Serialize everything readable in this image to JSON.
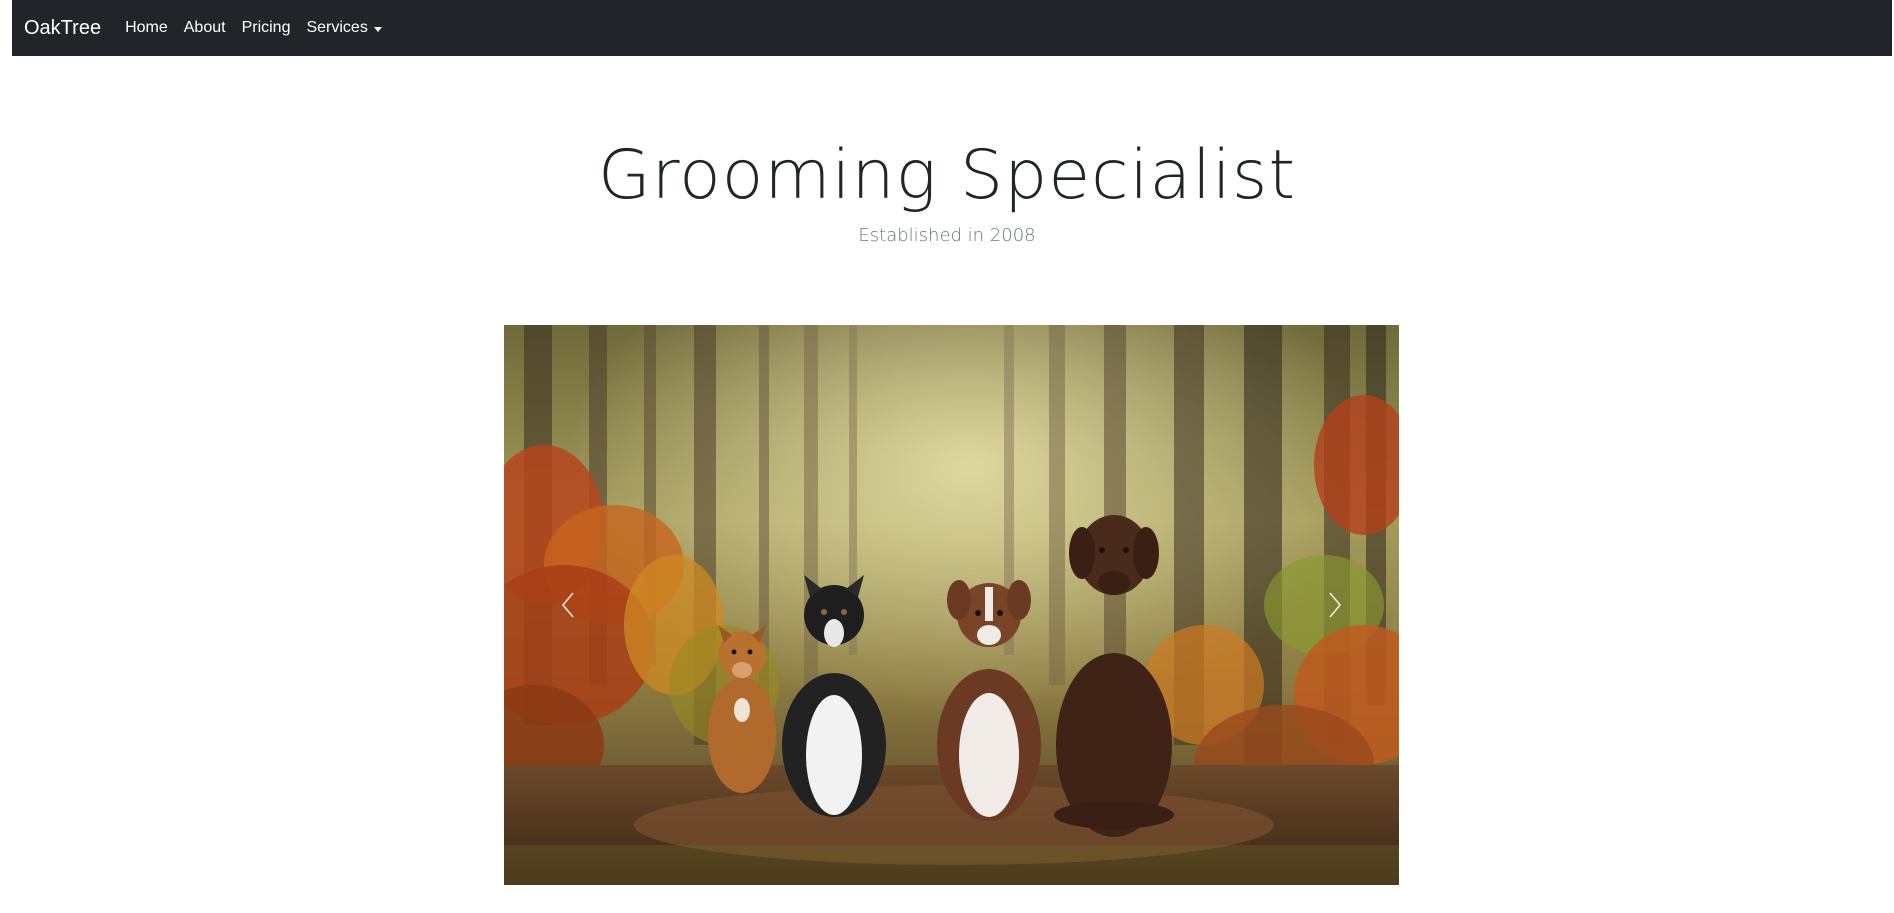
{
  "nav": {
    "brand": "OakTree",
    "items": [
      {
        "label": "Home"
      },
      {
        "label": "About"
      },
      {
        "label": "Pricing"
      },
      {
        "label": "Services",
        "dropdown": true
      }
    ]
  },
  "hero": {
    "title": "Grooming Specialist",
    "subtitle": "Established in 2008"
  },
  "carousel": {
    "image_description": "four dogs sitting on a forest path in autumn",
    "prev_icon": "chevron-left-icon",
    "next_icon": "chevron-right-icon"
  },
  "colors": {
    "navbar_bg": "#212529",
    "nav_text": "#ffffff",
    "title_text": "#212529",
    "subtitle_text": "#6c757d"
  }
}
